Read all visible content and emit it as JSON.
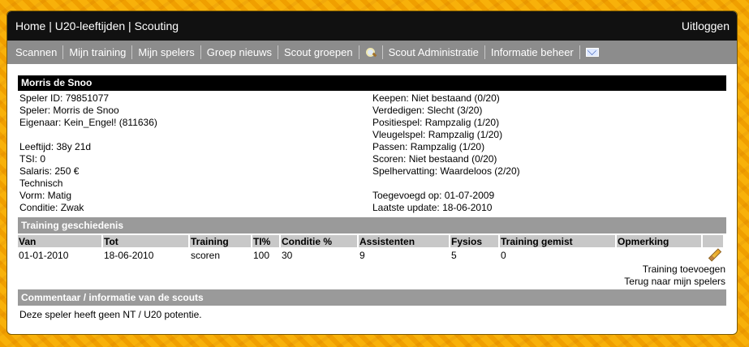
{
  "header": {
    "breadcrumb": [
      "Home",
      "U20-leeftijden",
      "Scouting"
    ],
    "separator": " | ",
    "logout": "Uitloggen"
  },
  "nav": {
    "items": [
      "Scannen",
      "Mijn training",
      "Mijn spelers",
      "Groep nieuws",
      "Scout groepen"
    ],
    "items2": [
      "Scout Administratie",
      "Informatie beheer"
    ],
    "icons": [
      "search-icon",
      "mail-icon"
    ]
  },
  "player": {
    "name": "Morris de Snoo",
    "left": [
      "Speler ID: 79851077",
      "Speler: Morris de Snoo",
      "Eigenaar: Kein_Engel! (811636)",
      "",
      "Leeftijd: 38y 21d",
      "TSI: 0",
      "Salaris: 250 €",
      "Technisch",
      "Vorm: Matig",
      "Conditie: Zwak"
    ],
    "right": [
      "Keepen: Niet bestaand (0/20)",
      "Verdedigen: Slecht (3/20)",
      "Positiespel: Rampzalig (1/20)",
      "Vleugelspel: Rampzalig (1/20)",
      "Passen: Rampzalig (1/20)",
      "Scoren: Niet bestaand (0/20)",
      "Spelhervatting: Waardeloos (2/20)",
      "",
      "Toegevoegd op: 01-07-2009",
      "Laatste update: 18-06-2010"
    ]
  },
  "training": {
    "title": "Training geschiedenis",
    "columns": [
      "Van",
      "Tot",
      "Training",
      "TI%",
      "Conditie %",
      "Assistenten",
      "Fysios",
      "Training gemist",
      "Opmerking",
      ""
    ],
    "rows": [
      [
        "01-01-2010",
        "18-06-2010",
        "scoren",
        "100",
        "30",
        "9",
        "5",
        "0",
        ""
      ]
    ],
    "add_link": "Training toevoegen",
    "back_link": "Terug naar mijn spelers"
  },
  "comments": {
    "title": "Commentaar / informatie van de scouts",
    "text": "Deze speler heeft geen NT / U20 potentie."
  }
}
